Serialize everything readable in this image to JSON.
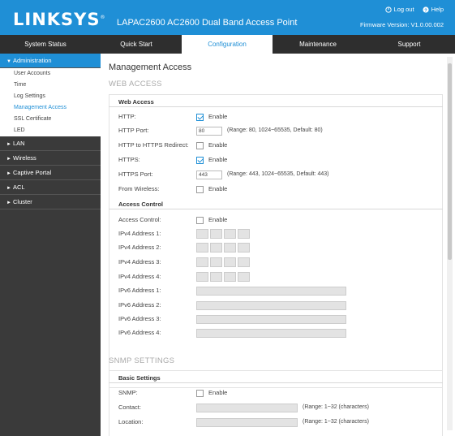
{
  "header": {
    "logo": "LINKSYS",
    "logo_mark": "®",
    "product_title": "LAPAC2600 AC2600 Dual Band Access Point",
    "logout_label": "Log out",
    "help_label": "Help",
    "firmware_label": "Firmware Version: V1.0.00.002"
  },
  "nav": {
    "tabs": [
      {
        "label": "System Status"
      },
      {
        "label": "Quick Start"
      },
      {
        "label": "Configuration"
      },
      {
        "label": "Maintenance"
      },
      {
        "label": "Support"
      }
    ],
    "active": "Configuration"
  },
  "sidebar": {
    "administration": {
      "label": "Administration",
      "items": [
        "User Accounts",
        "Time",
        "Log Settings",
        "Management Access",
        "SSL Certificate",
        "LED"
      ],
      "active_item": "Management Access"
    },
    "others": [
      "LAN",
      "Wireless",
      "Captive Portal",
      "ACL",
      "Cluster"
    ]
  },
  "main": {
    "page_title": "Management Access",
    "web_access_section": "WEB ACCESS",
    "web_access_subhead": "Web Access",
    "http": {
      "label": "HTTP:",
      "enable": "Enable",
      "checked": true
    },
    "http_port": {
      "label": "HTTP Port:",
      "value": "80",
      "hint": "(Range: 80, 1024~65535, Default: 80)"
    },
    "http_redirect": {
      "label": "HTTP to HTTPS Redirect:",
      "enable": "Enable",
      "checked": false
    },
    "https": {
      "label": "HTTPS:",
      "enable": "Enable",
      "checked": true
    },
    "https_port": {
      "label": "HTTPS Port:",
      "value": "443",
      "hint": "(Range: 443, 1024~65535, Default: 443)"
    },
    "from_wireless": {
      "label": "From Wireless:",
      "enable": "Enable",
      "checked": false
    },
    "access_control_subhead": "Access Control",
    "access_control": {
      "label": "Access Control:",
      "enable": "Enable",
      "checked": false
    },
    "ipv4": [
      "IPv4 Address 1:",
      "IPv4 Address 2:",
      "IPv4 Address 3:",
      "IPv4 Address 4:"
    ],
    "ipv6": [
      "IPv6 Address 1:",
      "IPv6 Address 2:",
      "IPv6 Address 3:",
      "IPv6 Address 4:"
    ],
    "snmp_section": "SNMP SETTINGS",
    "snmp_subhead": "Basic Settings",
    "snmp": {
      "label": "SNMP:",
      "enable": "Enable",
      "checked": false
    },
    "contact": {
      "label": "Contact:",
      "hint": "(Range: 1~32 (characters)"
    },
    "location": {
      "label": "Location:",
      "hint": "(Range: 1~32 (characters)"
    }
  },
  "colors": {
    "brand": "#1f8fd6",
    "nav_bg": "#2e2e2e",
    "sidebar_bg": "#3a3a3a"
  }
}
